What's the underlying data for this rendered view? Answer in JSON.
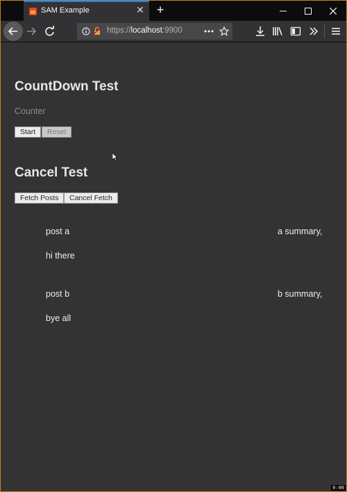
{
  "browser": {
    "tab_title": "SAM Example",
    "url_scheme": "https://",
    "url_host": "localhost",
    "url_port": ":9900"
  },
  "page": {
    "countdown": {
      "heading": "CountDown Test",
      "counter_label": "Counter",
      "start_label": "Start",
      "reset_label": "Reset"
    },
    "cancel": {
      "heading": "Cancel Test",
      "fetch_label": "Fetch Posts",
      "cancel_label": "Cancel Fetch"
    },
    "posts": [
      {
        "title": "post a",
        "summary": "a summary,",
        "body": "hi there"
      },
      {
        "title": "post b",
        "summary": "b summary,",
        "body": "bye all"
      }
    ]
  },
  "corner_badge": "0:00"
}
